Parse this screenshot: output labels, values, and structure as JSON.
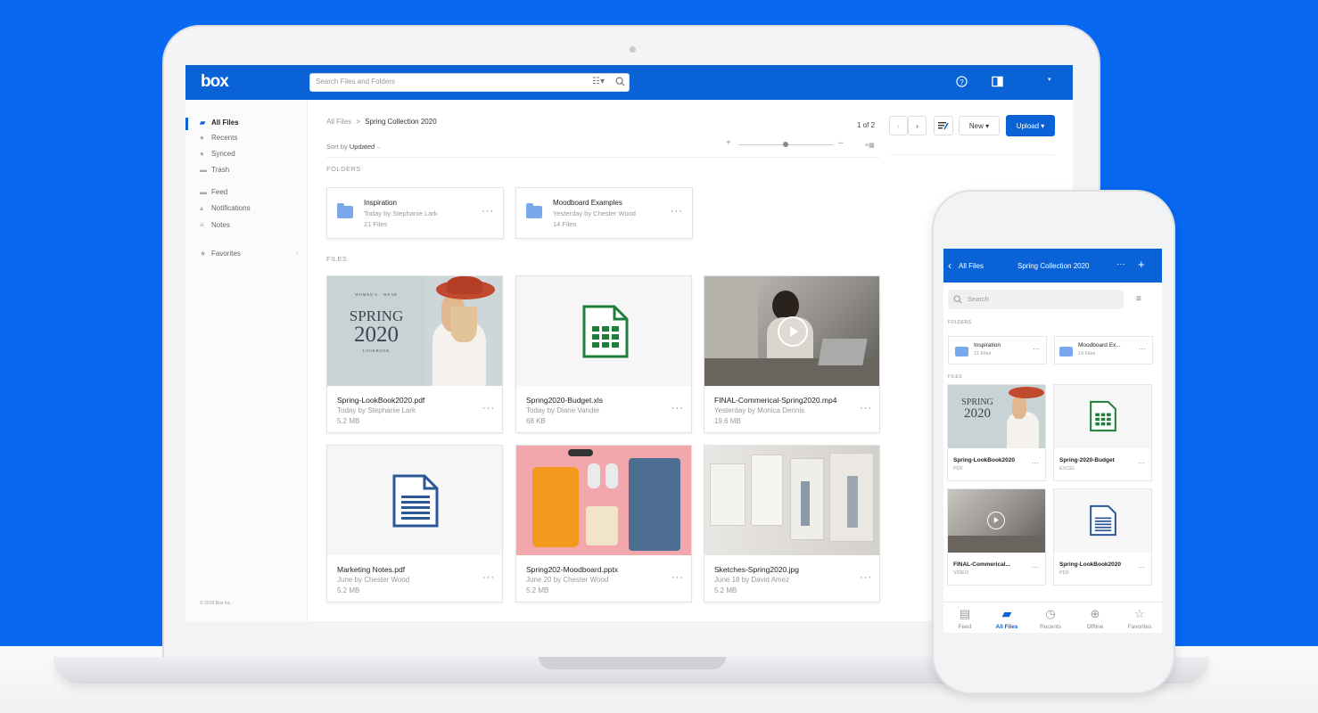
{
  "colors": {
    "brand_blue": "#0a63d6",
    "backdrop": "#0868f2",
    "excel_green": "#1f7f3a",
    "doc_blue": "#2b5797"
  },
  "desktop": {
    "logo": "box",
    "search_placeholder": "Search Files and Folders",
    "icons": {
      "filter": "filter-icon",
      "search": "search-icon",
      "help": "help-icon",
      "panel": "panel-icon",
      "account": "account-dropdown-icon"
    },
    "sidebar": {
      "items": [
        {
          "label": "All Files",
          "icon": "folder-icon"
        },
        {
          "label": "Recents",
          "icon": "clock-icon"
        },
        {
          "label": "Synced",
          "icon": "check-icon"
        },
        {
          "label": "Trash",
          "icon": "trash-icon"
        },
        {
          "label": "Feed",
          "icon": "feed-icon"
        },
        {
          "label": "Notifications",
          "icon": "bell-icon"
        },
        {
          "label": "Notes",
          "icon": "notes-icon"
        },
        {
          "label": "Favorites",
          "icon": "star-icon"
        }
      ],
      "copyright": "© 2018 Box Inc."
    },
    "breadcrumb": {
      "root": "All Files",
      "sep": ">",
      "current": "Spring Collection 2020"
    },
    "pagination": "1 of 2",
    "buttons": {
      "new": "New ▾",
      "upload": "Upload ▾"
    },
    "sort": {
      "label": "Sort by",
      "value": "Updated"
    },
    "sections": {
      "folders": "FOLDERS",
      "files": "FILES"
    },
    "folders": [
      {
        "name": "Inspiration",
        "sub": "Today by Stephanie Lark",
        "count": "21 Files"
      },
      {
        "name": "Moodboard Examples",
        "sub": "Yesterday by Chester Wood",
        "count": "14 Files"
      }
    ],
    "files": [
      {
        "name": "Spring-LookBook2020.pdf",
        "sub": "Today by Stephanie Lark",
        "size": "5.2 MB",
        "thumb": "lookbook"
      },
      {
        "name": "Spring2020-Budget.xls",
        "sub": "Today by Diane Vander",
        "size": "68 KB",
        "thumb": "excel"
      },
      {
        "name": "FINAL-Commerical-Spring2020.mp4",
        "sub": "Yesterday by Monica Dennis",
        "size": "19.6 MB",
        "thumb": "video"
      },
      {
        "name": "Marketing Notes.pdf",
        "sub": "June by Chester Wood",
        "size": "5.2 MB",
        "thumb": "doc"
      },
      {
        "name": "Spring202-Moodboard.pptx",
        "sub": "June 20 by Chester Wood",
        "size": "5.2 MB",
        "thumb": "moodboard"
      },
      {
        "name": "Sketches-Spring2020.jpg",
        "sub": "June 18 by David Amez",
        "size": "5.2 MB",
        "thumb": "sketches"
      }
    ],
    "lookbook_text": {
      "top": "WOMEN'S · WEAR",
      "spring": "SPRING",
      "year": "2020",
      "bottom": "LOOKBOOK"
    }
  },
  "mobile": {
    "back": "All Files",
    "title": "Spring Collection 2020",
    "search_placeholder": "Search",
    "sections": {
      "folders": "FOLDERS",
      "files": "FILES"
    },
    "folders": [
      {
        "name": "Inspiration",
        "count": "21 Files"
      },
      {
        "name": "Moodboard Ex...",
        "count": "14 Files"
      }
    ],
    "files": [
      {
        "name": "Spring-LookBook2020",
        "type": "PDF"
      },
      {
        "name": "Spring-2020-Budget",
        "type": "EXCEL"
      },
      {
        "name": "FINAL-Commerical...",
        "type": "VIDEO"
      },
      {
        "name": "Spring-LookBook2020",
        "type": "PDF"
      }
    ],
    "tabs": [
      {
        "label": "Feed",
        "icon": "feed-icon"
      },
      {
        "label": "All Files",
        "icon": "folder-icon"
      },
      {
        "label": "Recents",
        "icon": "clock-icon"
      },
      {
        "label": "Offline",
        "icon": "download-icon"
      },
      {
        "label": "Favorites",
        "icon": "star-icon"
      }
    ]
  }
}
